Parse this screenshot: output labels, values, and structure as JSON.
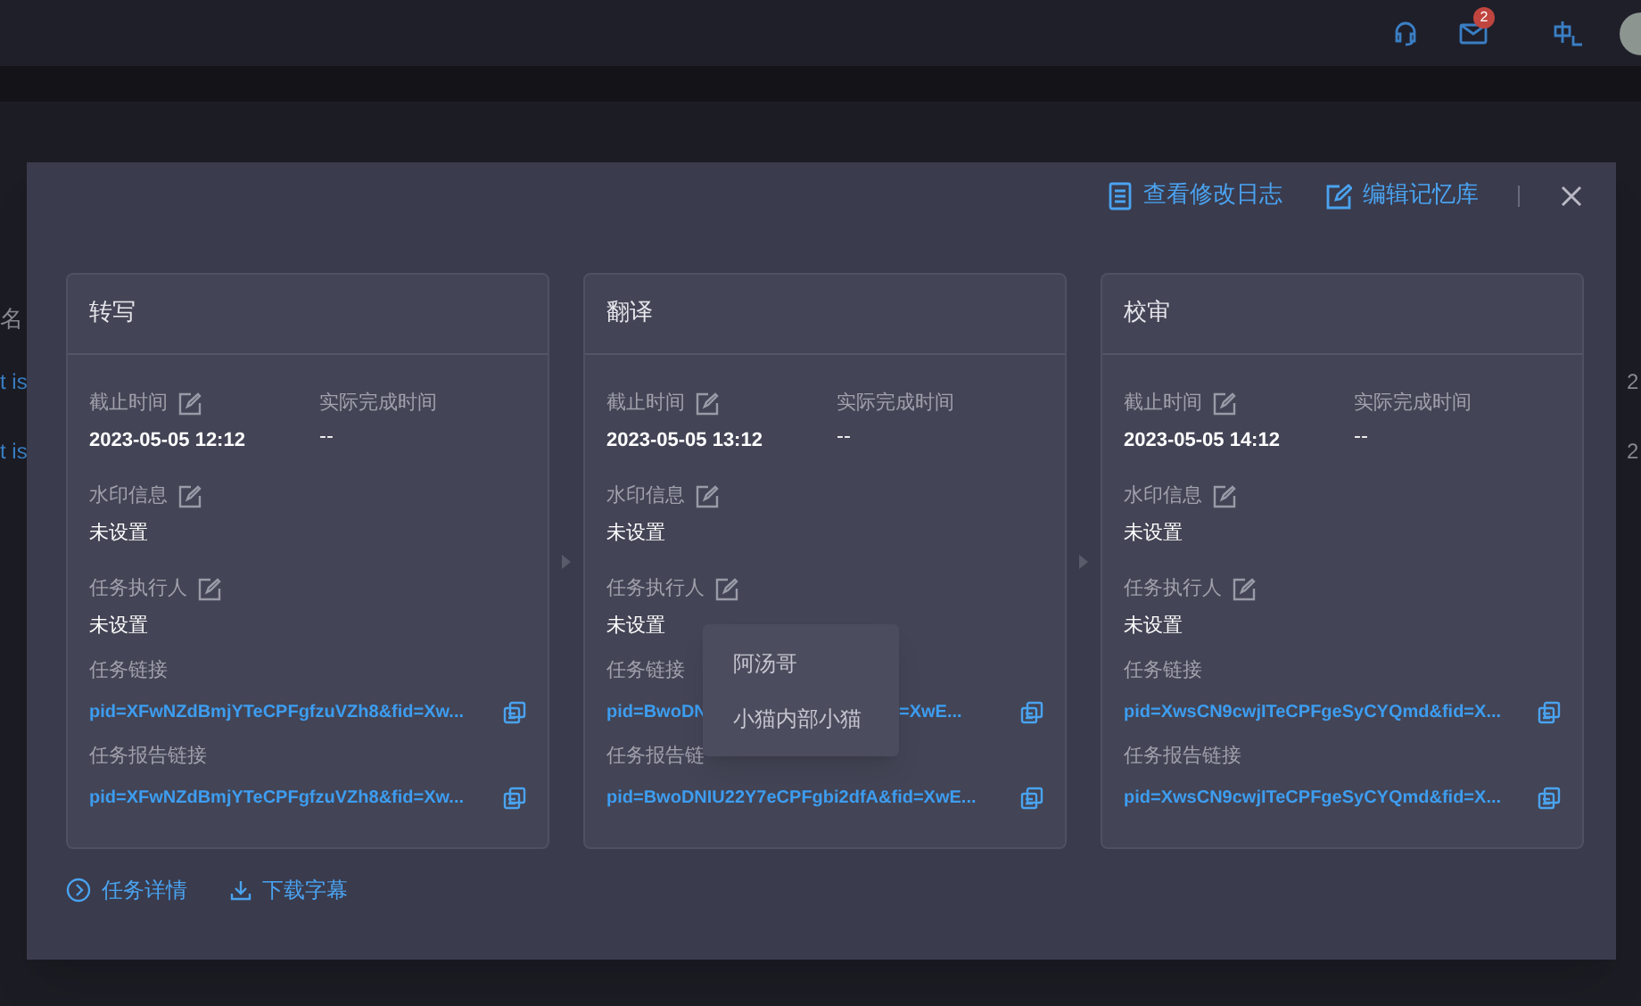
{
  "top_bar": {
    "mail_badge": "2"
  },
  "background": {
    "left_header": "名",
    "left_rows": [
      "t is",
      "t is"
    ],
    "right_rows": [
      "2",
      "2"
    ]
  },
  "modal": {
    "actions": [
      {
        "kind": "log",
        "label": "查看修改日志"
      },
      {
        "kind": "edit",
        "label": "编辑记忆库"
      }
    ],
    "stages": [
      {
        "title": "转写",
        "deadline_label": "截止时间",
        "deadline": "2023-05-05 12:12",
        "actual_label": "实际完成时间",
        "actual": "--",
        "watermark_label": "水印信息",
        "watermark": "未设置",
        "assignee_label": "任务执行人",
        "assignee": "未设置",
        "link_label": "任务链接",
        "link_parts": [
          "pid=XFwNZdBmjYTeCPFgfzuVZh8&fid=Xw..."
        ],
        "report_label": "任务报告链接",
        "report_link": "pid=XFwNZdBmjYTeCPFgfzuVZh8&fid=Xw..."
      },
      {
        "title": "翻译",
        "deadline_label": "截止时间",
        "deadline": "2023-05-05 13:12",
        "actual_label": "实际完成时间",
        "actual": "--",
        "watermark_label": "水印信息",
        "watermark": "未设置",
        "assignee_label": "任务执行人",
        "assignee": "未设置",
        "link_label": "任务链接",
        "link_parts": [
          "pid=BwoDN",
          "=XwE..."
        ],
        "report_label": "任务报告链",
        "report_link": "pid=BwoDNIU22Y7eCPFgbi2dfA&fid=XwE...",
        "assignee_dropdown": [
          "阿汤哥",
          "小猫内部小猫"
        ]
      },
      {
        "title": "校审",
        "deadline_label": "截止时间",
        "deadline": "2023-05-05 14:12",
        "actual_label": "实际完成时间",
        "actual": "--",
        "watermark_label": "水印信息",
        "watermark": "未设置",
        "assignee_label": "任务执行人",
        "assignee": "未设置",
        "link_label": "任务链接",
        "link_parts": [
          "pid=XwsCN9cwjITeCPFgeSyCYQmd&fid=X..."
        ],
        "report_label": "任务报告链接",
        "report_link": "pid=XwsCN9cwjITeCPFgeSyCYQmd&fid=X..."
      }
    ],
    "footer_links": [
      {
        "kind": "details",
        "label": "任务详情"
      },
      {
        "kind": "download",
        "label": "下载字幕"
      }
    ]
  }
}
